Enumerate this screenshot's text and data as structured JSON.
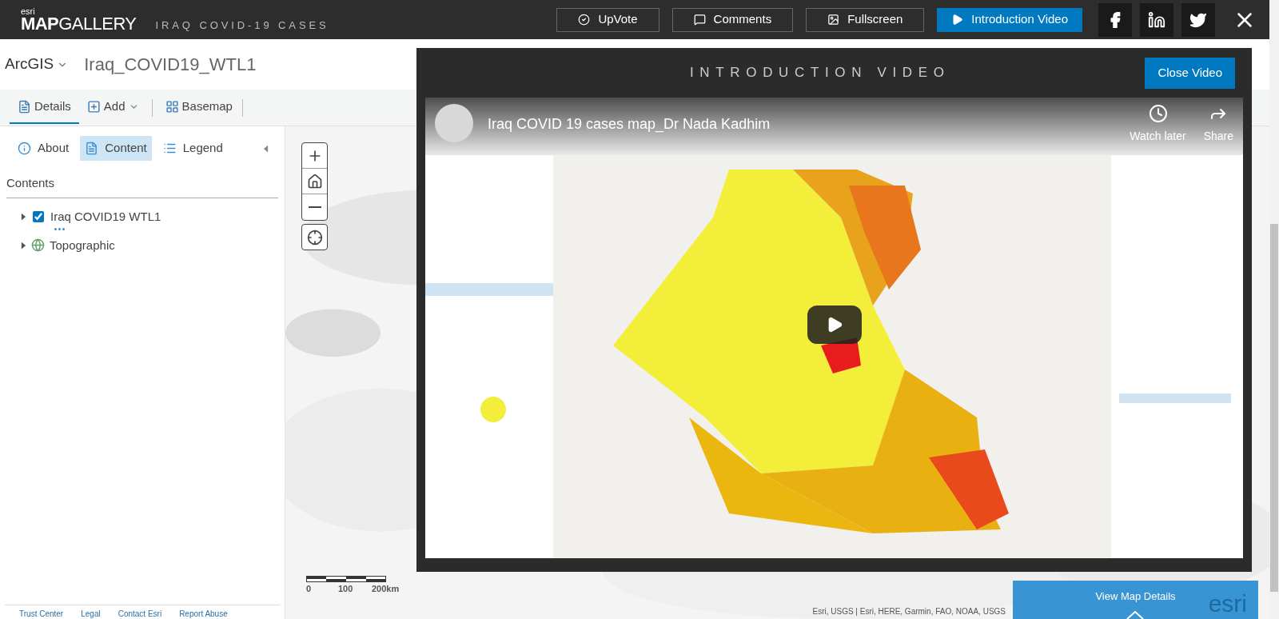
{
  "header": {
    "brand_small": "esri",
    "brand_bold": "MAP",
    "brand_light": "GALLERY",
    "title": "IRAQ COVID-19 CASES",
    "buttons": [
      {
        "label": "UpVote",
        "kind": "upvote",
        "primary": false
      },
      {
        "label": "Comments",
        "kind": "comments",
        "primary": false
      },
      {
        "label": "Fullscreen",
        "kind": "fullscreen",
        "primary": false
      },
      {
        "label": "Introduction Video",
        "kind": "video",
        "primary": true
      }
    ],
    "social": [
      {
        "kind": "facebook"
      },
      {
        "kind": "linkedin"
      },
      {
        "kind": "twitter"
      }
    ]
  },
  "app": {
    "product": "ArcGIS",
    "map_title": "Iraq_COVID19_WTL1"
  },
  "toolbar": [
    {
      "label": "Details",
      "kind": "details",
      "selected": true,
      "dropdown": false
    },
    {
      "label": "Add",
      "kind": "add",
      "selected": false,
      "dropdown": true
    },
    {
      "label": "Basemap",
      "kind": "basemap",
      "selected": false,
      "dropdown": false
    }
  ],
  "panel_tabs": [
    {
      "label": "About",
      "kind": "about",
      "selected": false
    },
    {
      "label": "Content",
      "kind": "content",
      "selected": true
    },
    {
      "label": "Legend",
      "kind": "legend",
      "selected": false
    }
  ],
  "contents": {
    "heading": "Contents",
    "layer": {
      "name": "Iraq COVID19 WTL1",
      "checked": true
    },
    "basemap": {
      "name": "Topographic"
    }
  },
  "footer_links": [
    "Trust Center",
    "Legal",
    "Contact Esri",
    "Report Abuse"
  ],
  "scale_bar": {
    "labels": [
      "0",
      "100",
      "200km"
    ]
  },
  "attribution": "Esri, USGS | Esri, HERE, Garmin, FAO, NOAA, USGS",
  "details_panel": {
    "label": "View Map Details",
    "logo": "esri"
  },
  "video_modal": {
    "title": "INTRODUCTION VIDEO",
    "close": "Close Video",
    "video_title": "Iraq COVID 19 cases map_Dr Nada Kadhim",
    "actions": [
      {
        "label": "Watch later",
        "kind": "clock"
      },
      {
        "label": "Share",
        "kind": "share"
      }
    ]
  }
}
